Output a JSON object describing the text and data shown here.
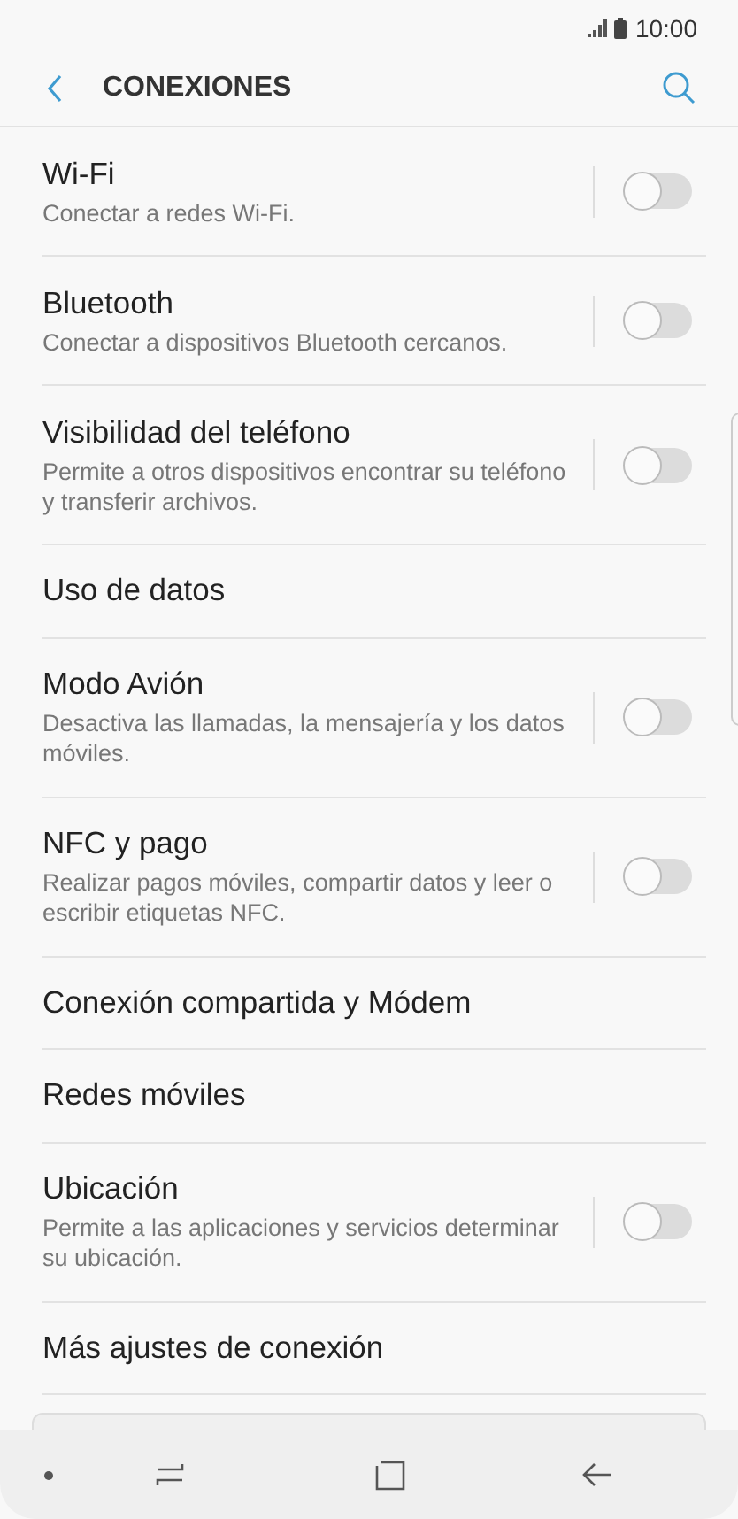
{
  "status_bar": {
    "time": "10:00"
  },
  "header": {
    "title": "CONEXIONES"
  },
  "items": [
    {
      "kind": "toggle",
      "title": "Wi-Fi",
      "subtitle": "Conectar a redes Wi-Fi.",
      "on": false
    },
    {
      "kind": "toggle",
      "title": "Bluetooth",
      "subtitle": "Conectar a dispositivos Bluetooth cercanos.",
      "on": false
    },
    {
      "kind": "toggle",
      "title": "Visibilidad del teléfono",
      "subtitle": "Permite a otros dispositivos encontrar su teléfono y transferir archivos.",
      "on": false
    },
    {
      "kind": "link",
      "title": "Uso de datos"
    },
    {
      "kind": "toggle",
      "title": "Modo Avión",
      "subtitle": "Desactiva las llamadas, la mensajería y los datos móviles.",
      "on": false
    },
    {
      "kind": "toggle",
      "title": "NFC y pago",
      "subtitle": "Realizar pagos móviles, compartir datos y leer o escribir etiquetas NFC.",
      "on": false
    },
    {
      "kind": "link",
      "title": "Conexión compartida y Módem"
    },
    {
      "kind": "link",
      "title": "Redes móviles"
    },
    {
      "kind": "toggle",
      "title": "Ubicación",
      "subtitle": "Permite a las aplicaciones y servicios determinar su ubicación.",
      "on": false
    },
    {
      "kind": "link",
      "title": "Más ajustes de conexión"
    }
  ]
}
